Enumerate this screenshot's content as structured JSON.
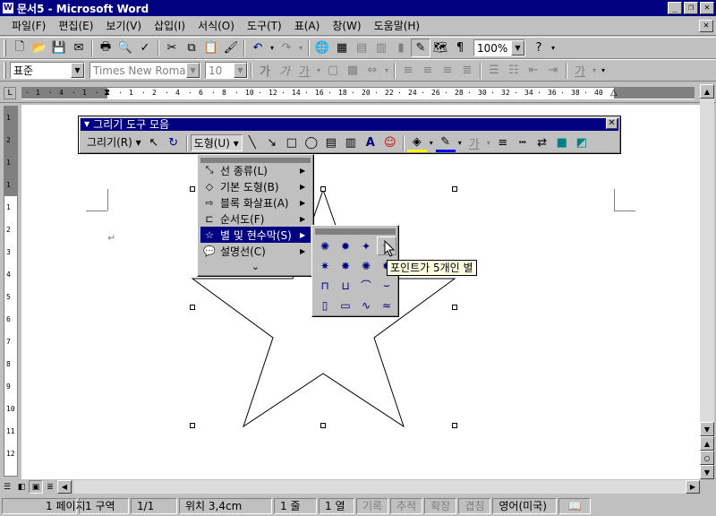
{
  "window": {
    "title": "문서5 - Microsoft Word",
    "app_glyph": "W"
  },
  "menubar": {
    "items": [
      "파일(F)",
      "편집(E)",
      "보기(V)",
      "삽입(I)",
      "서식(O)",
      "도구(T)",
      "표(A)",
      "창(W)",
      "도움말(H)"
    ]
  },
  "toolbar": {
    "zoom": "100%",
    "style_value": "표준",
    "font_value": "Times New Roman",
    "size_value": "10",
    "char_buttons": [
      "가",
      "가",
      "가",
      "가"
    ]
  },
  "ruler": {
    "numbers": [
      "1",
      "4",
      "1",
      "2",
      "1",
      "2",
      "4",
      "6",
      "8",
      "10",
      "12",
      "14",
      "16",
      "18",
      "20",
      "22",
      "24",
      "26",
      "28",
      "30",
      "32",
      "34",
      "36",
      "38",
      "40"
    ]
  },
  "vruler": {
    "numbers": [
      "1",
      "2",
      "1",
      "1",
      "1",
      "2",
      "3",
      "4",
      "5",
      "6",
      "7",
      "8",
      "9",
      "10",
      "11",
      "12"
    ]
  },
  "drawing_toolbar": {
    "title": "그리기 도구 모음",
    "draw_label": "그리기(R)",
    "shapes_label": "도형(U)"
  },
  "shapes_menu": {
    "items": [
      {
        "label": "선 종류(L)"
      },
      {
        "label": "기본 도형(B)"
      },
      {
        "label": "블록 화살표(A)"
      },
      {
        "label": "순서도(F)"
      },
      {
        "label": "별 및 현수막(S)"
      },
      {
        "label": "설명선(C)"
      }
    ],
    "more": "⌄"
  },
  "tooltip": "포인트가 5개인 별",
  "statusbar": {
    "page": "1 페이지",
    "section": "1 구역",
    "pages": "1/1",
    "position": "위치 3,4cm",
    "line": "1 줄",
    "column": "1 열",
    "rec": "기록",
    "trk": "추적",
    "ext": "확장",
    "ovr": "겹침",
    "lang": "영어(미국)"
  },
  "colors": {
    "titlebar": "#000080",
    "selection": "#000080",
    "tooltip_bg": "#ffffe1"
  }
}
